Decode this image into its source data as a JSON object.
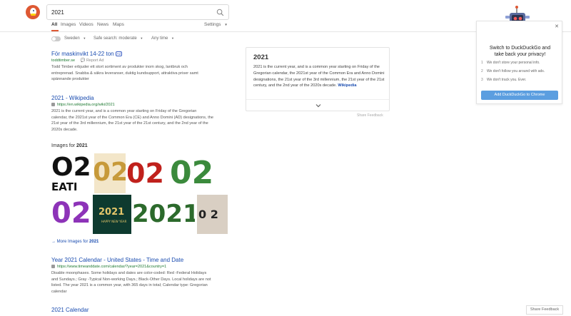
{
  "search": {
    "query": "2021"
  },
  "nav": {
    "tabs": [
      {
        "label": "All"
      },
      {
        "label": "Images"
      },
      {
        "label": "Videos"
      },
      {
        "label": "News"
      },
      {
        "label": "Maps"
      }
    ],
    "settings": "Settings"
  },
  "filters": {
    "region": "Sweden",
    "safe_search": "Safe search: moderate",
    "time": "Any time"
  },
  "results": [
    {
      "title": "För maskinvikt 14-22 ton",
      "badge": "Ad",
      "url": "toddtimber.se",
      "report": "Report Ad",
      "snippet_lines": [
        "Todd Timber erbjuder ett stort sortiment av produkter inom skog, lantbruk och",
        "entreprenad. Snabba & säkra leveranser, duktig kundsupport, attraktiva priser samt",
        "spännande produkter"
      ]
    },
    {
      "title": "2021 - Wikipedia",
      "url": "https://en.wikipedia.org/wiki/2021",
      "snippet_lines": [
        "2021 is the current year, and is a common year starting on Friday of the Gregorian",
        "calendar, the 2021st year of the Common Era (CE) and Anno Domini (AD) designations, the",
        "21st year of the 3rd millennium, the 21st year of the 21st century, and the 2nd year of the",
        "2020s decade."
      ]
    },
    {
      "title": "Year 2021 Calendar - United States - Time and Date",
      "url": "https://www.timeanddate.com/calendar/?year=2021&country=1",
      "snippet_lines": [
        "Disable moonphases. Some holidays and dates are color-coded: Red -Federal Holidays",
        "and Sundays.; Gray -Typical Non-working Days.; Black-Other Days. Local holidays are not",
        "listed. The year 2021 is a common year, with 365 days in total; Calendar type: Gregorian",
        "calendar"
      ]
    },
    {
      "title": "2021 Calendar"
    }
  ],
  "images": {
    "heading_prefix": "Images for",
    "heading_query": "2021",
    "more_prefix": "More Images for",
    "more_query": "2021",
    "tiles": [
      {
        "text": "O2",
        "sub": "EATI"
      },
      {
        "text": "02"
      },
      {
        "text": "02"
      },
      {
        "text": "02"
      },
      {
        "text": "02"
      },
      {
        "text": "2021",
        "sub": "HAPPY NEW YEAR"
      },
      {
        "text": "2021"
      },
      {
        "text": "2021"
      },
      {
        "text": "0 2"
      }
    ]
  },
  "infobox": {
    "title": "2021",
    "text": "2021 is the current year, and is a common year starting on Friday of the Gregorian calendar, the 2021st year of the Common Era and Anno Domini designations, the 21st year of the 3rd millennium, the 21st year of the 21st century, and the 2nd year of the 2020s decade.",
    "source": "Wikipedia",
    "share_feedback": "Share Feedback"
  },
  "promo": {
    "title_line1": "Switch to DuckDuckGo and",
    "title_line2": "take back your privacy!",
    "points": [
      {
        "n": "1",
        "text": "We don't store your personal info."
      },
      {
        "n": "2",
        "text": "We don't follow you around with ads."
      },
      {
        "n": "3",
        "text": "We don't track you. Ever."
      }
    ],
    "button": "Add DuckDuckGo to Chrome"
  },
  "share_feedback_button": "Share Feedback",
  "colors": {
    "accent": "#de5833",
    "link": "#1a4cb0",
    "url_green": "#1f7a33",
    "button_blue": "#5b9ee0"
  }
}
